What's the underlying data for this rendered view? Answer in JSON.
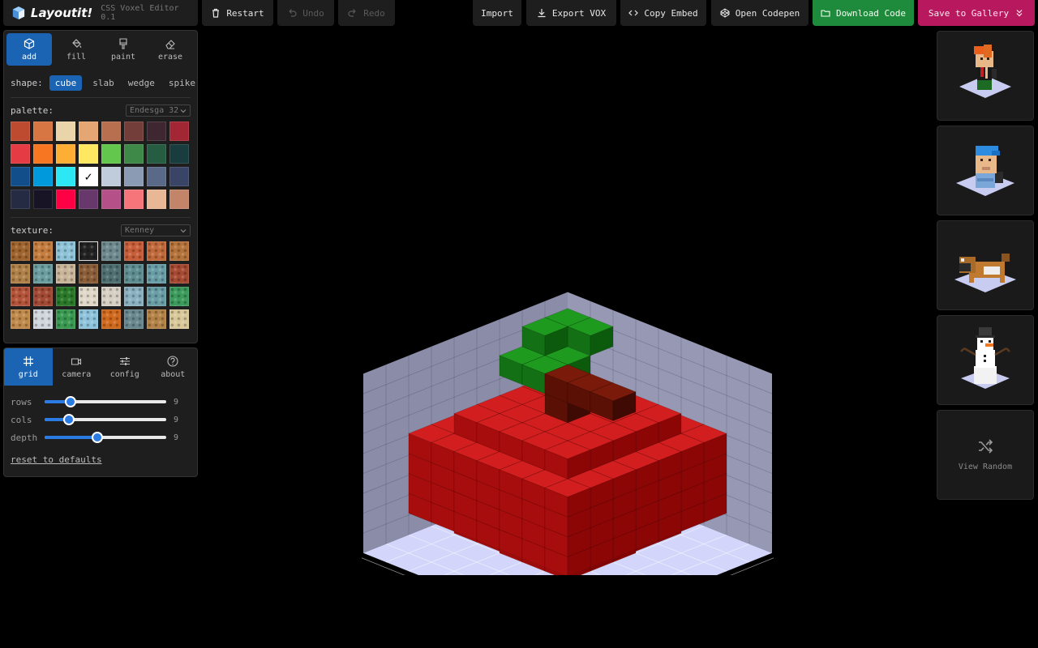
{
  "app": {
    "name": "Layoutit!",
    "version": "CSS Voxel Editor 0.1"
  },
  "toolbar": {
    "restart": "Restart",
    "undo": "Undo",
    "redo": "Redo",
    "import": "Import",
    "export_vox": "Export VOX",
    "copy_embed": "Copy Embed",
    "open_codepen": "Open Codepen",
    "download_code": "Download Code",
    "save_gallery": "Save to Gallery",
    "colors": {
      "download": "#1e8a3c",
      "save": "#b8185e"
    }
  },
  "tools": {
    "items": [
      {
        "label": "add",
        "icon": "cube-icon",
        "active": true
      },
      {
        "label": "fill",
        "icon": "bucket-icon",
        "active": false
      },
      {
        "label": "paint",
        "icon": "brush-icon",
        "active": false
      },
      {
        "label": "erase",
        "icon": "eraser-icon",
        "active": false
      }
    ],
    "shape_label": "shape:",
    "shapes": [
      "cube",
      "slab",
      "wedge",
      "spike"
    ],
    "active_shape": "cube",
    "palette_label": "palette:",
    "palette_select": "Endesga 32",
    "palette_colors": [
      "#be4a2f",
      "#d77643",
      "#ead4aa",
      "#e4a672",
      "#b86f50",
      "#733e39",
      "#3e2731",
      "#a22633",
      "#e43b44",
      "#f77622",
      "#feae34",
      "#fee761",
      "#63c74d",
      "#3e8948",
      "#265c42",
      "#193c3e",
      "#124e89",
      "#0099db",
      "#2ce8f5",
      "#ffffff",
      "#c0cbdc",
      "#8b9bb4",
      "#5a6988",
      "#3a4466",
      "#262b44",
      "#181425",
      "#ff0044",
      "#68386c",
      "#b55088",
      "#f6757a",
      "#e8b796",
      "#c28569"
    ],
    "selected_color": "#ffffff",
    "check_mark": "✓",
    "texture_label": "texture:",
    "texture_select": "Kenney",
    "textures": [
      "#a0642e",
      "#c47d3f",
      "#8ec3d8",
      "#222222",
      "#6e8a8e",
      "#c75e3a",
      "#c06a3c",
      "#b5733c",
      "#b08148",
      "#6c9ea0",
      "#c9b59a",
      "#8a5e38",
      "#4f6f71",
      "#5f8e92",
      "#6a9ea6",
      "#a74a33",
      "#b4543a",
      "#a24a35",
      "#2a7a2a",
      "#e0d8c8",
      "#d6d0c4",
      "#8bb0c0",
      "#6a9ea6",
      "#3c9a5c",
      "#c08a4c",
      "#d0d6dc",
      "#3a9a52",
      "#8fc4dc",
      "#d06a1e",
      "#6a8890",
      "#b38348",
      "#d8c89a"
    ]
  },
  "settings": {
    "tabs": [
      {
        "label": "grid",
        "icon": "grid-icon",
        "active": true
      },
      {
        "label": "camera",
        "icon": "camera-icon",
        "active": false
      },
      {
        "label": "config",
        "icon": "sliders-icon",
        "active": false
      },
      {
        "label": "about",
        "icon": "help-icon",
        "active": false
      }
    ],
    "sliders": [
      {
        "label": "rows",
        "value": "9",
        "level": 0.21
      },
      {
        "label": "cols",
        "value": "9",
        "level": 0.2
      },
      {
        "label": "depth",
        "value": "9",
        "level": 0.43
      }
    ],
    "reset": "reset to defaults"
  },
  "gallery": {
    "items": [
      "red-haired figure model",
      "blue cap worker model",
      "pug dog model",
      "snowman model"
    ],
    "random_label": "View Random"
  }
}
